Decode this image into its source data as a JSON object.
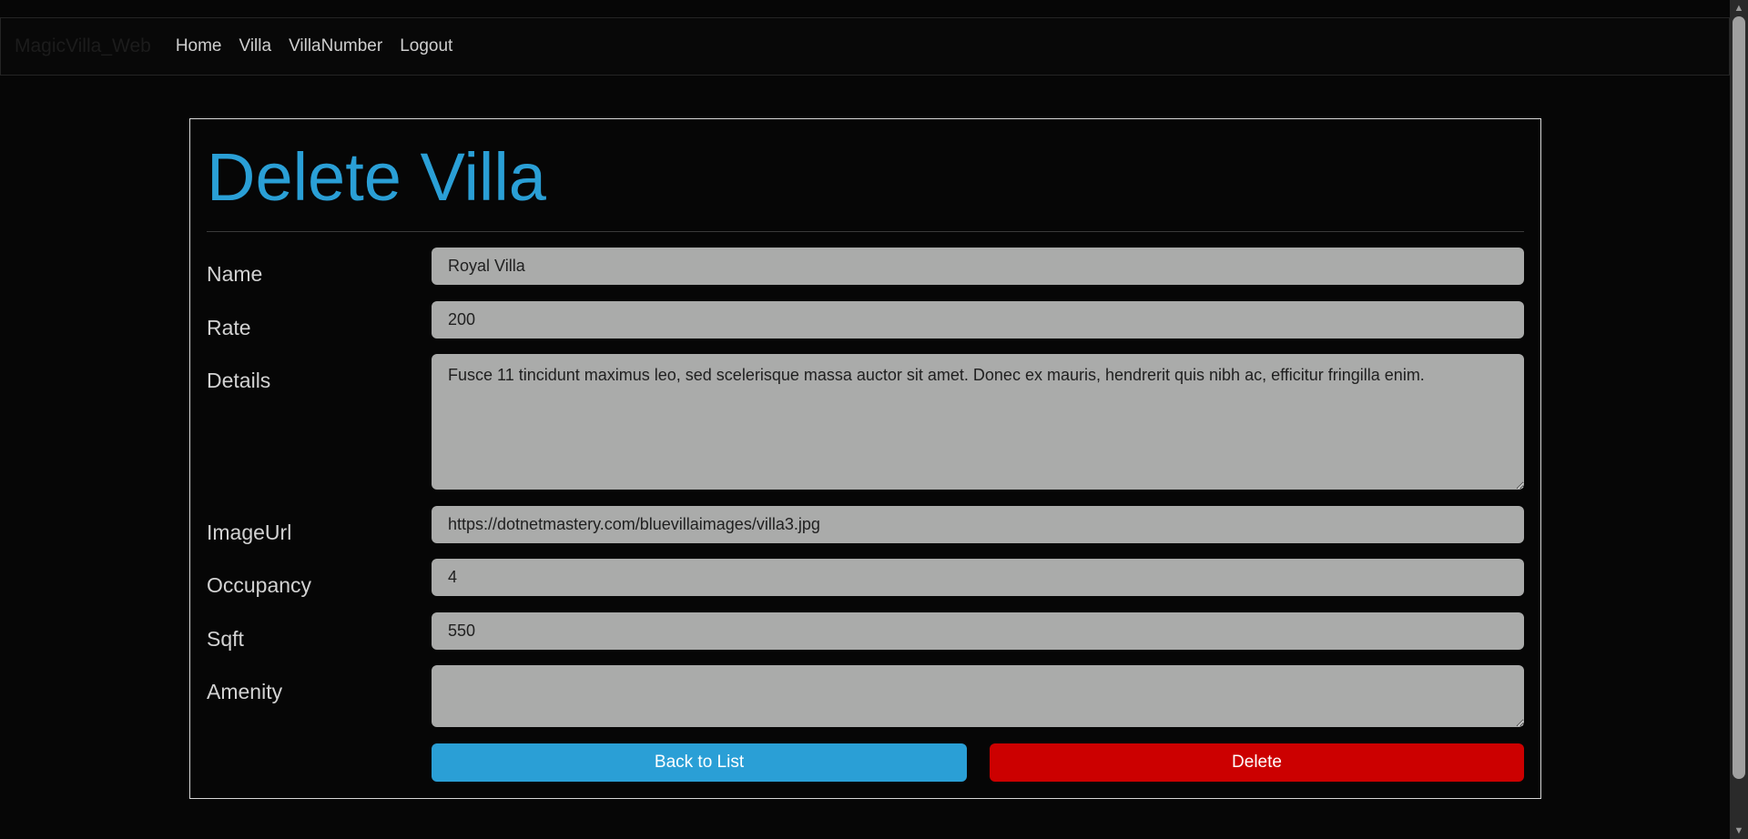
{
  "navbar": {
    "brand": "MagicVilla_Web",
    "links": [
      "Home",
      "Villa",
      "VillaNumber",
      "Logout"
    ]
  },
  "page": {
    "title": "Delete Villa"
  },
  "form": {
    "fields": [
      {
        "label": "Name",
        "value": "Royal Villa"
      },
      {
        "label": "Rate",
        "value": "200"
      },
      {
        "label": "Details",
        "value": "Fusce 11 tincidunt maximus leo, sed scelerisque massa auctor sit amet. Donec ex mauris, hendrerit quis nibh ac, efficitur fringilla enim."
      },
      {
        "label": "ImageUrl",
        "value": "https://dotnetmastery.com/bluevillaimages/villa3.jpg"
      },
      {
        "label": "Occupancy",
        "value": "4"
      },
      {
        "label": "Sqft",
        "value": "550"
      },
      {
        "label": "Amenity",
        "value": ""
      }
    ]
  },
  "buttons": {
    "back": "Back to List",
    "delete": "Delete"
  },
  "colors": {
    "accent": "#2a9fd6",
    "danger": "#cc0000",
    "background": "#060606",
    "field": "#aaabaa"
  }
}
